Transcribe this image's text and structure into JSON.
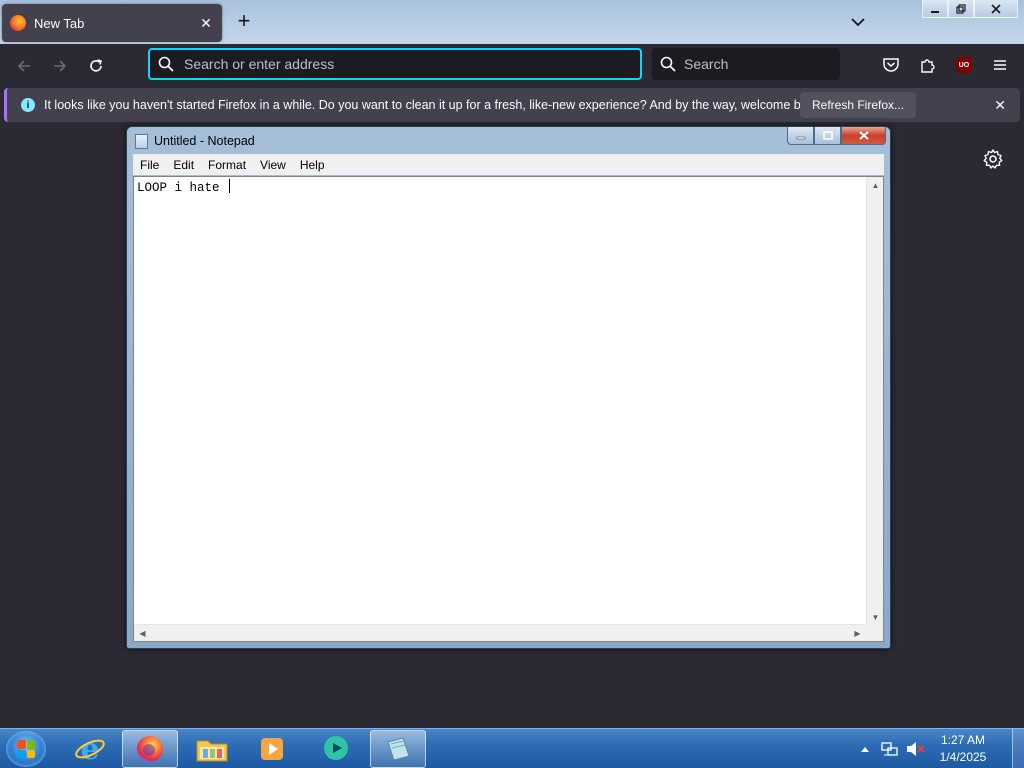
{
  "firefox": {
    "tab_title": "New Tab",
    "url_placeholder": "Search or enter address",
    "search_placeholder": "Search",
    "ublock_label": "UO",
    "notification": {
      "message": "It looks like you haven't started Firefox in a while. Do you want to clean it up for a fresh, like-new experience? And by the way, welcome back!",
      "button_label": "Refresh Firefox..."
    }
  },
  "notepad": {
    "title": "Untitled - Notepad",
    "menu": [
      "File",
      "Edit",
      "Format",
      "View",
      "Help"
    ],
    "content": "LOOP i hate "
  },
  "taskbar": {
    "apps": [
      "start-orb",
      "internet-explorer",
      "firefox",
      "file-explorer",
      "media-player",
      "messenger",
      "notepad"
    ],
    "clock_time": "1:27 AM",
    "clock_date": "1/4/2025"
  },
  "colors": {
    "firefox_dark": "#2b2a33",
    "url_focus": "#00ddff",
    "notice_accent": "#a970ff",
    "taskbar_blue": "#2d6cb4"
  }
}
